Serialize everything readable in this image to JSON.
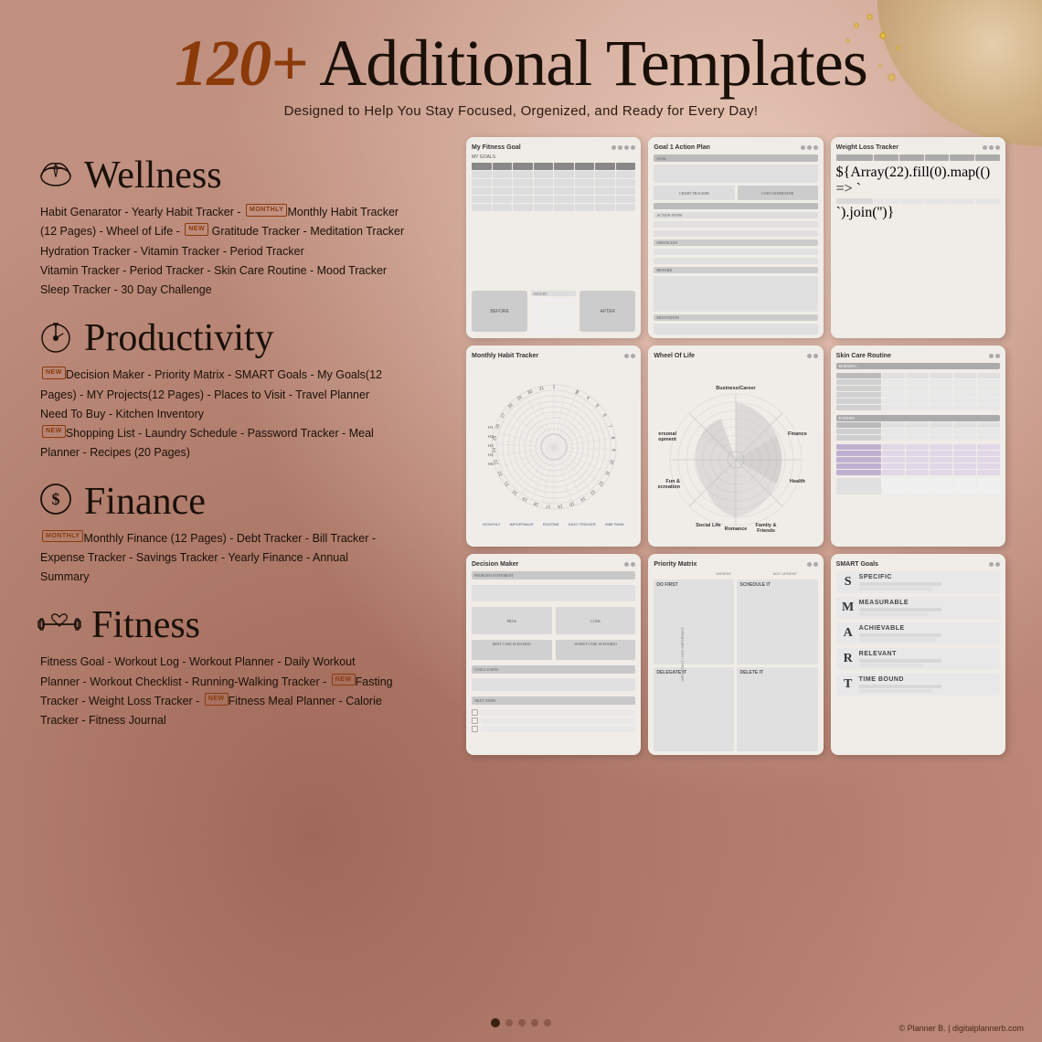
{
  "header": {
    "number": "120+",
    "title": "Additional Templates",
    "subtitle": "Designed to Help You Stay Focused, Orgenized, and Ready for Every Day!"
  },
  "sections": [
    {
      "id": "wellness",
      "icon": "🌸",
      "title": "Wellness",
      "items": "Habit Genarator - Yearly Habit Tracker - Monthly Habit Tracker (12 Pages) - Wheel of Life -  Gratitude Tracker - Meditation Tracker Hydration Tracker - Vitamin Tracker - Period Tracker Vitamin Tracker - Period Tracker - Skin Care Routine - Mood Tracker Sleep Tracker - 30 Day Challenge",
      "badge1": "MONTHLY",
      "badge2": "NEW"
    },
    {
      "id": "productivity",
      "icon": "⏱",
      "title": "Productivity",
      "items": "Decision Maker - Priority Matrix - SMART Goals - My Goals(12 Pages) - MY Projects(12 Pages) - Places to Visit - Travel Planner Need To Buy - Kitchen Inventory Shopping List - Laundry Schedule - Password Tracker - Meal Planner - Recipes (20 Pages)",
      "badge1": "NEW",
      "badge2": "NEW"
    },
    {
      "id": "finance",
      "icon": "$",
      "title": "Finance",
      "items": "Monthly Finance (12 Pages) - Debt Tracker - Bill Tracker - Expense Tracker - Savings Tracker - Yearly Finance - Annual Summary",
      "badge1": "MONTHLY"
    },
    {
      "id": "fitness",
      "icon": "💪",
      "title": "Fitness",
      "items": "Fitness Goal - Workout Log - Workout Planner - Daily Workout Planner - Workout Checklist - Running-Walking Tracker - Fasting Tracker - Weight Loss Tracker - Fitness Meal Planner - Calorie Tracker - Fitness Journal",
      "badge1": "NEW",
      "badge2": "NEW"
    }
  ],
  "templates": [
    {
      "id": "fitness-goal",
      "title": "My Fitness Goal"
    },
    {
      "id": "goal-action",
      "title": "Goal 1 Action Plan"
    },
    {
      "id": "weight-loss",
      "title": "Weight Loss Tracker"
    },
    {
      "id": "monthly-habit",
      "title": "Monthly Habit Tracker"
    },
    {
      "id": "wheel-of-life",
      "title": "Wheel Of Life"
    },
    {
      "id": "skincare",
      "title": "Skin Care Routine"
    },
    {
      "id": "decision",
      "title": "Decision Maker"
    },
    {
      "id": "priority",
      "title": "Priority Matrix"
    },
    {
      "id": "smart",
      "title": "SMART Goals"
    }
  ],
  "pagination": {
    "dots": [
      true,
      false,
      false,
      false,
      false
    ],
    "active": 0
  },
  "footer": "© Planner B. | digitalplannerb.com",
  "smart_letters": [
    "S",
    "M",
    "A",
    "R",
    "T"
  ],
  "smart_words": [
    "SPECIFIC",
    "MEASURABLE",
    "ACHIEVABLE",
    "RELEVANT",
    "TIME BOUND"
  ],
  "wheel_labels": [
    "Business/Career",
    "Finance",
    "Health",
    "Family & Friends",
    "Romance",
    "Social Life",
    "Fun & Recreation",
    "Personal Development"
  ],
  "priority_labels": [
    "DO FIRST",
    "SCHEDULE IT",
    "DELEGATE IT",
    "DELETE IT"
  ]
}
